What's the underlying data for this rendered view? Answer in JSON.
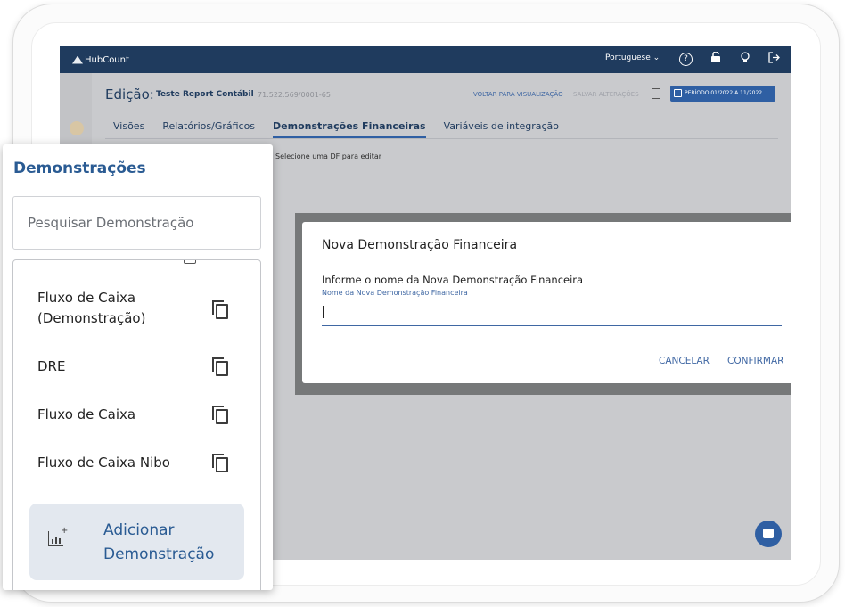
{
  "app": {
    "logo_text": "HubCount",
    "language": "Portuguese",
    "language_chevron": "⌄",
    "icons": [
      "help-icon",
      "lock-icon",
      "lightbulb-icon",
      "logout-icon"
    ]
  },
  "header": {
    "edit_label": "Edição:",
    "company_name": "Teste Report Contábil",
    "cnpj": "71.522.569/0001-65",
    "voltar_label": "VOLTAR PARA VISUALIZAÇÃO",
    "salvar_label": "SALVAR ALTERAÇÕES",
    "periodo_label": "PERÍODO 01/2022 A 11/2022"
  },
  "tabs": [
    {
      "label": "Visões"
    },
    {
      "label": "Relatórios/Gráficos"
    },
    {
      "label": "Demonstrações Financeiras",
      "active": true
    },
    {
      "label": "Variáveis de integração"
    }
  ],
  "main": {
    "hint": "Selecione uma DF para editar"
  },
  "dialog": {
    "title": "Nova Demonstração Financeira",
    "prompt": "Informe o nome da Nova Demonstração Financeira",
    "field_label": "Nome da Nova Demonstração Financeira",
    "field_value": "",
    "cancel_label": "CANCELAR",
    "confirm_label": "CONFIRMAR"
  },
  "panel": {
    "title": "Demonstrações",
    "search_placeholder": "Pesquisar Demonstração",
    "items": [
      {
        "label_line1": "Fluxo de Caixa",
        "label_line2": "(Demonstração)"
      },
      {
        "label_line1": "DRE"
      },
      {
        "label_line1": "Fluxo de Caixa"
      },
      {
        "label_line1": "Fluxo de Caixa Nibo"
      }
    ],
    "add_label_line1": "Adicionar",
    "add_label_line2": "Demonstração"
  },
  "colors": {
    "brand_dark": "#1f3b5e",
    "accent": "#2f5fa3",
    "panel_title": "#2a5b93"
  }
}
